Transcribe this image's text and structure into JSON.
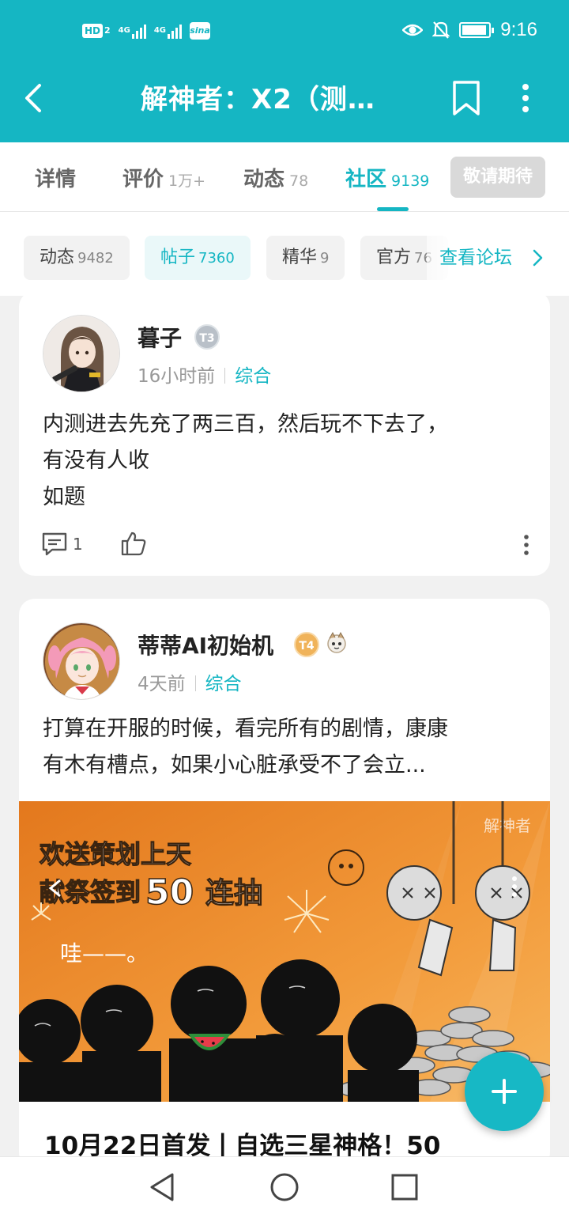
{
  "status_bar": {
    "hd_label": "HD",
    "hd_sub": "2",
    "net1": "4G",
    "net2": "4G",
    "weibo": "sina",
    "time": "9:16"
  },
  "header": {
    "title": "解神者：X2（测试...",
    "bg_color": "#15b6c3"
  },
  "tabs": [
    {
      "label": "详情",
      "count": ""
    },
    {
      "label": "评价",
      "count": "1万+"
    },
    {
      "label": "动态",
      "count": "78"
    },
    {
      "label": "社区",
      "count": "9139",
      "active": true
    }
  ],
  "expect_button": "敬请期待",
  "filters": [
    {
      "label": "动态",
      "count": "9482"
    },
    {
      "label": "帖子",
      "count": "7360",
      "active": true
    },
    {
      "label": "精华",
      "count": "9"
    },
    {
      "label": "官方",
      "count": "76"
    }
  ],
  "forum_link": "查看论坛",
  "posts": [
    {
      "author": "暮子",
      "badge": "T3",
      "time": "16小时前",
      "category": "综合",
      "text_line1": "内测进去先充了两三百，然后玩不下去了，",
      "text_line2": "有没有人收",
      "text_line3": "如题",
      "comment_count": "1"
    },
    {
      "author": "蒂蒂AI初始机",
      "badge": "T4",
      "time": "4天前",
      "category": "综合",
      "text_line1": "打算在开服的时候，看完所有的剧情，康康",
      "text_line2": "有木有槽点，如果小心脏承受不了会立...",
      "image": {
        "line1": "欢送策划上天",
        "line2_prefix": "献祭签到",
        "line2_num": "50",
        "line2_suffix": "连抽",
        "exclaim": "哇——。",
        "watermark": "解神者"
      },
      "title": "10月22日首发丨自选三星神格！50"
    }
  ],
  "accent_color": "#15b6c3"
}
